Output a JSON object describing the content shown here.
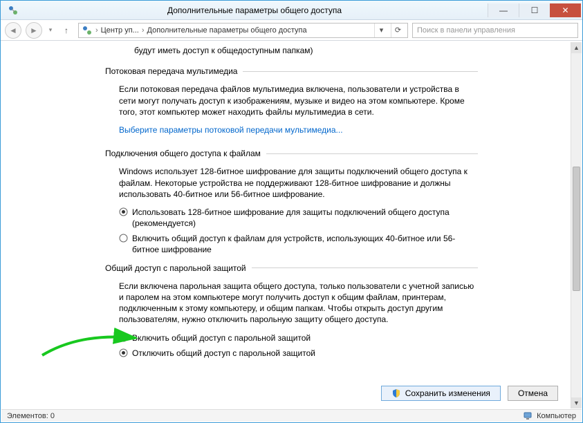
{
  "title": "Дополнительные параметры общего доступа",
  "breadcrumb": {
    "item1": "Центр уп...",
    "item2": "Дополнительные параметры общего доступа"
  },
  "search_placeholder": "Поиск в панели управления",
  "fragment_text": "будут иметь доступ к общедоступным папкам)",
  "section_media": {
    "title": "Потоковая передача мультимедиа",
    "body": "Если потоковая передача файлов мультимедиа включена, пользователи и устройства в сети могут получать доступ к изображениям, музыке и видео на этом компьютере. Кроме того, этот компьютер может находить файлы мультимедиа в сети.",
    "link": "Выберите параметры потоковой передачи мультимедиа..."
  },
  "section_fileshare": {
    "title": "Подключения общего доступа к файлам",
    "body": "Windows использует 128-битное шифрование для защиты подключений общего доступа к файлам. Некоторые устройства не поддерживают 128-битное шифрование и должны использовать 40-битное или 56-битное шифрование.",
    "radio1": "Использовать 128-битное шифрование для защиты подключений общего доступа (рекомендуется)",
    "radio2": "Включить общий доступ к файлам для устройств, использующих 40-битное или 56-битное шифрование"
  },
  "section_password": {
    "title": "Общий доступ с парольной защитой",
    "body": "Если включена парольная защита общего доступа, только пользователи с учетной записью и паролем на этом компьютере могут получить доступ к общим файлам, принтерам, подключенным к этому компьютеру, и общим папкам. Чтобы открыть доступ другим пользователям, нужно отключить парольную защиту общего доступа.",
    "radio1": "Включить общий доступ с парольной защитой",
    "radio2": "Отключить общий доступ с парольной защитой"
  },
  "buttons": {
    "save": "Сохранить изменения",
    "cancel": "Отмена"
  },
  "statusbar": {
    "left": "Элементов: 0",
    "right": "Компьютер"
  }
}
